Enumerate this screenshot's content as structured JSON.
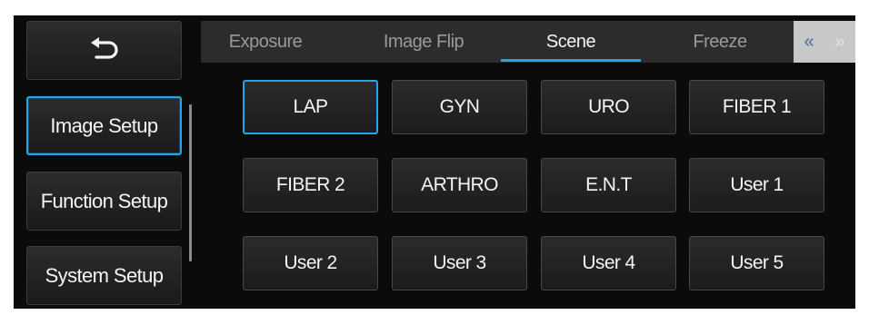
{
  "sidebar": {
    "back_icon": "return-arrow-icon",
    "items": [
      {
        "label": "Image Setup",
        "selected": true
      },
      {
        "label": "Function Setup",
        "selected": false
      },
      {
        "label": "System Setup",
        "selected": false
      }
    ]
  },
  "tabs": {
    "items": [
      {
        "label": "Exposure",
        "active": false
      },
      {
        "label": "Image Flip",
        "active": false
      },
      {
        "label": "Scene",
        "active": true
      },
      {
        "label": "Freeze",
        "active": false
      }
    ],
    "prev_label": "«",
    "next_label": "»"
  },
  "scenes": {
    "buttons": [
      {
        "label": "LAP",
        "selected": true
      },
      {
        "label": "GYN",
        "selected": false
      },
      {
        "label": "URO",
        "selected": false
      },
      {
        "label": "FIBER 1",
        "selected": false
      },
      {
        "label": "FIBER 2",
        "selected": false
      },
      {
        "label": "ARTHRO",
        "selected": false
      },
      {
        "label": "E.N.T",
        "selected": false
      },
      {
        "label": "User 1",
        "selected": false
      },
      {
        "label": "User 2",
        "selected": false
      },
      {
        "label": "User 3",
        "selected": false
      },
      {
        "label": "User 4",
        "selected": false
      },
      {
        "label": "User 5",
        "selected": false
      }
    ]
  },
  "colors": {
    "accent": "#2aa3e6",
    "background": "#0b0b0b",
    "tab_bar": "#2c2c2c"
  }
}
